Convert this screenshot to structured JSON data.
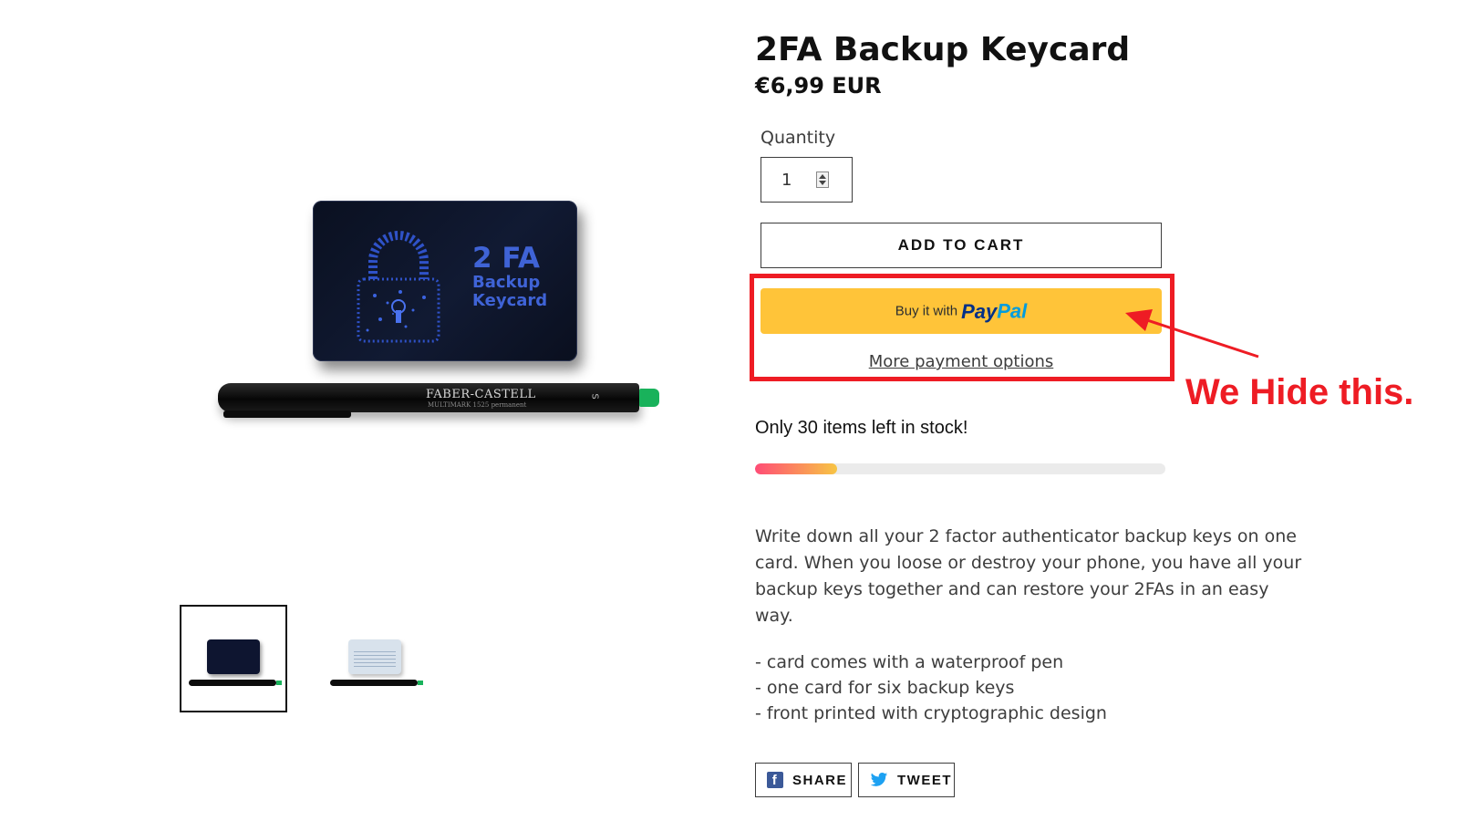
{
  "product": {
    "title": "2FA Backup Keycard",
    "price": "€6,99 EUR"
  },
  "images": {
    "card_text_big": "2 FA",
    "card_text_line1": "Backup",
    "card_text_line2": "Keycard",
    "pen_brand": "FABER-CASTELL",
    "pen_sub": "MULTIMARK 1525 permanent",
    "pen_size": "S",
    "thumbnails": [
      {
        "name": "keycard-front-thumbnail",
        "selected": true
      },
      {
        "name": "keycard-back-thumbnail",
        "selected": false
      }
    ]
  },
  "quantity": {
    "label": "Quantity",
    "value": "1"
  },
  "buttons": {
    "add_to_cart": "ADD TO CART",
    "paypal_prefix": "Buy it with",
    "paypal_pay": "Pay",
    "paypal_pal": "Pal",
    "more_payment_options": "More payment options"
  },
  "annotation": {
    "text": "We Hide this.",
    "color": "#ee1c24"
  },
  "stock": {
    "text": "Only 30 items left in stock!",
    "bar_fraction": 0.2
  },
  "description": {
    "paragraph": "Write down all your 2 factor authenticator backup keys on one card. When you loose or destroy your phone, you have all your backup keys together and can restore your 2FAs in an easy way.",
    "features": [
      "- card comes with a waterproof pen",
      "- one card for six backup keys",
      "- front printed with cryptographic design"
    ]
  },
  "social": {
    "share": "SHARE",
    "tweet": "TWEET"
  },
  "colors": {
    "paypal_yellow": "#ffc439",
    "paypal_dark_blue": "#003087",
    "paypal_light_blue": "#009cde",
    "facebook_blue": "#3b5998",
    "twitter_blue": "#1da1f2"
  }
}
